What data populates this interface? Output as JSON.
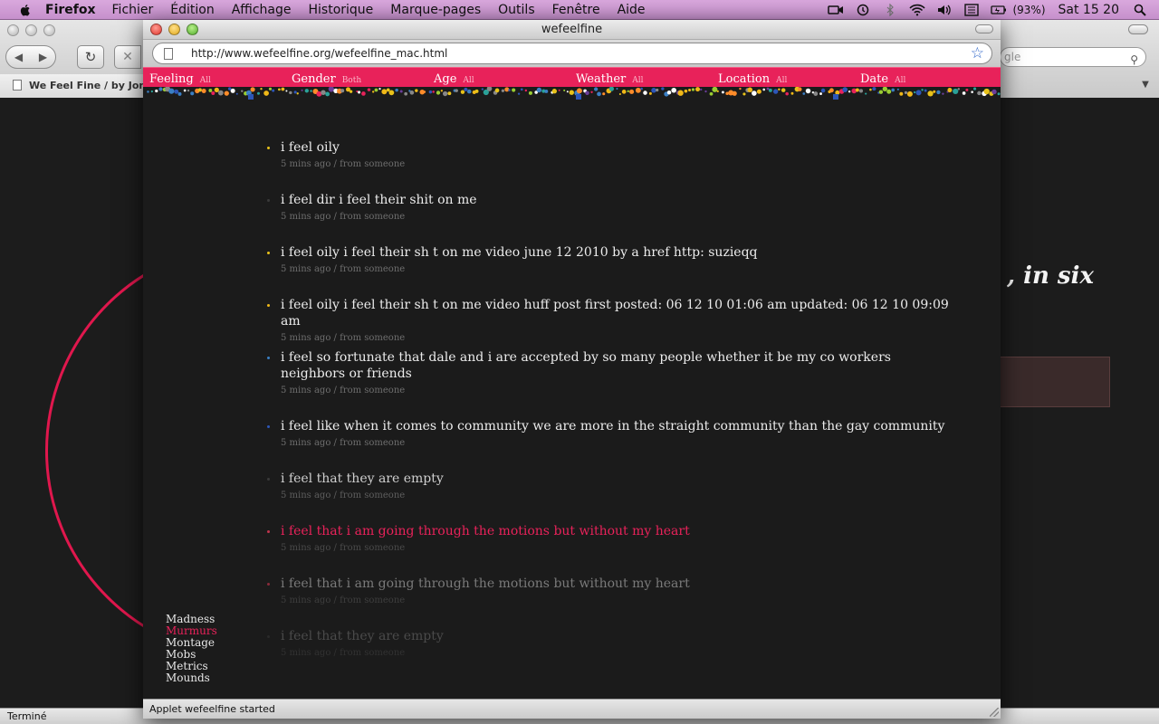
{
  "menubar": {
    "app_name": "Firefox",
    "menus": [
      "Fichier",
      "Édition",
      "Affichage",
      "Historique",
      "Marque-pages",
      "Outils",
      "Fenêtre",
      "Aide"
    ],
    "battery": "(93%)",
    "clock": "Sat 15 20"
  },
  "bg_window": {
    "tab_title": "We Feel Fine / by Jona",
    "search_placeholder": "gle",
    "headline": ", in six",
    "status": "Terminé"
  },
  "popup": {
    "title": "wefeelfine",
    "url": "http://www.wefeelfine.org/wefeelfine_mac.html",
    "filters": [
      {
        "name": "Feeling",
        "value": "All"
      },
      {
        "name": "Gender",
        "value": "Both"
      },
      {
        "name": "Age",
        "value": "All"
      },
      {
        "name": "Weather",
        "value": "All"
      },
      {
        "name": "Location",
        "value": "All"
      },
      {
        "name": "Date",
        "value": "All"
      }
    ],
    "murmurs": [
      {
        "text": "i feel oily",
        "meta": "5 mins ago / from someone",
        "bullet": "#e8c21a",
        "color": "#ececec",
        "meta_color": "#6e6e6e"
      },
      {
        "text": "i feel dir i feel their shit on me",
        "meta": "5 mins ago / from someone",
        "bullet": "#3a3a3a",
        "color": "#ececec",
        "meta_color": "#6e6e6e"
      },
      {
        "text": "i feel oily i feel their sh t on me video june 12 2010 by a href http: suzieqq",
        "meta": "5 mins ago / from someone",
        "bullet": "#e8c21a",
        "color": "#ececec",
        "meta_color": "#6e6e6e"
      },
      {
        "text": "i feel oily i feel their sh t on me video huff post first posted: 06 12 10 01:06 am updated: 06 12 10 09:09 am",
        "meta": "5 mins ago / from someone",
        "bullet": "#f0b818",
        "color": "#ececec",
        "meta_color": "#6e6e6e"
      },
      {
        "text": "i feel so fortunate that dale and i are accepted by so many people whether it be my co workers neighbors or friends",
        "meta": "5 mins ago / from someone",
        "bullet": "#3a7fc4",
        "color": "#ececec",
        "meta_color": "#6e6e6e"
      },
      {
        "text": "i feel like when it comes to community we are more in the straight community than the gay community",
        "meta": "5 mins ago / from someone",
        "bullet": "#2d56b8",
        "color": "#ececec",
        "meta_color": "#6e6e6e"
      },
      {
        "text": "i feel that they are empty",
        "meta": "5 mins ago / from someone",
        "bullet": "#3a3a3a",
        "color": "#cfcfcf",
        "meta_color": "#5e5e5e"
      },
      {
        "text": "i feel that i am going through the motions but without my heart",
        "meta": "5 mins ago / from someone",
        "bullet": "#c0344c",
        "color": "#e8225a",
        "meta_color": "#4a4a4a"
      },
      {
        "text": "i feel that i am going through the motions but without my heart",
        "meta": "5 mins ago / from someone",
        "bullet": "#8a2a3a",
        "color": "#7a7a7a",
        "meta_color": "#3e3e3e"
      },
      {
        "text": "i feel that they are empty",
        "meta": "5 mins ago / from someone",
        "bullet": "#2a2a2a",
        "color": "#4a4a4a",
        "meta_color": "#323232"
      }
    ],
    "nav": [
      {
        "label": "Madness",
        "active": false
      },
      {
        "label": "Murmurs",
        "active": true
      },
      {
        "label": "Montage",
        "active": false
      },
      {
        "label": "Mobs",
        "active": false
      },
      {
        "label": "Metrics",
        "active": false
      },
      {
        "label": "Mounds",
        "active": false
      }
    ],
    "status": "Applet wefeelfine started"
  },
  "colors": {
    "accent": "#e8225a",
    "background": "#1b1b1b"
  }
}
